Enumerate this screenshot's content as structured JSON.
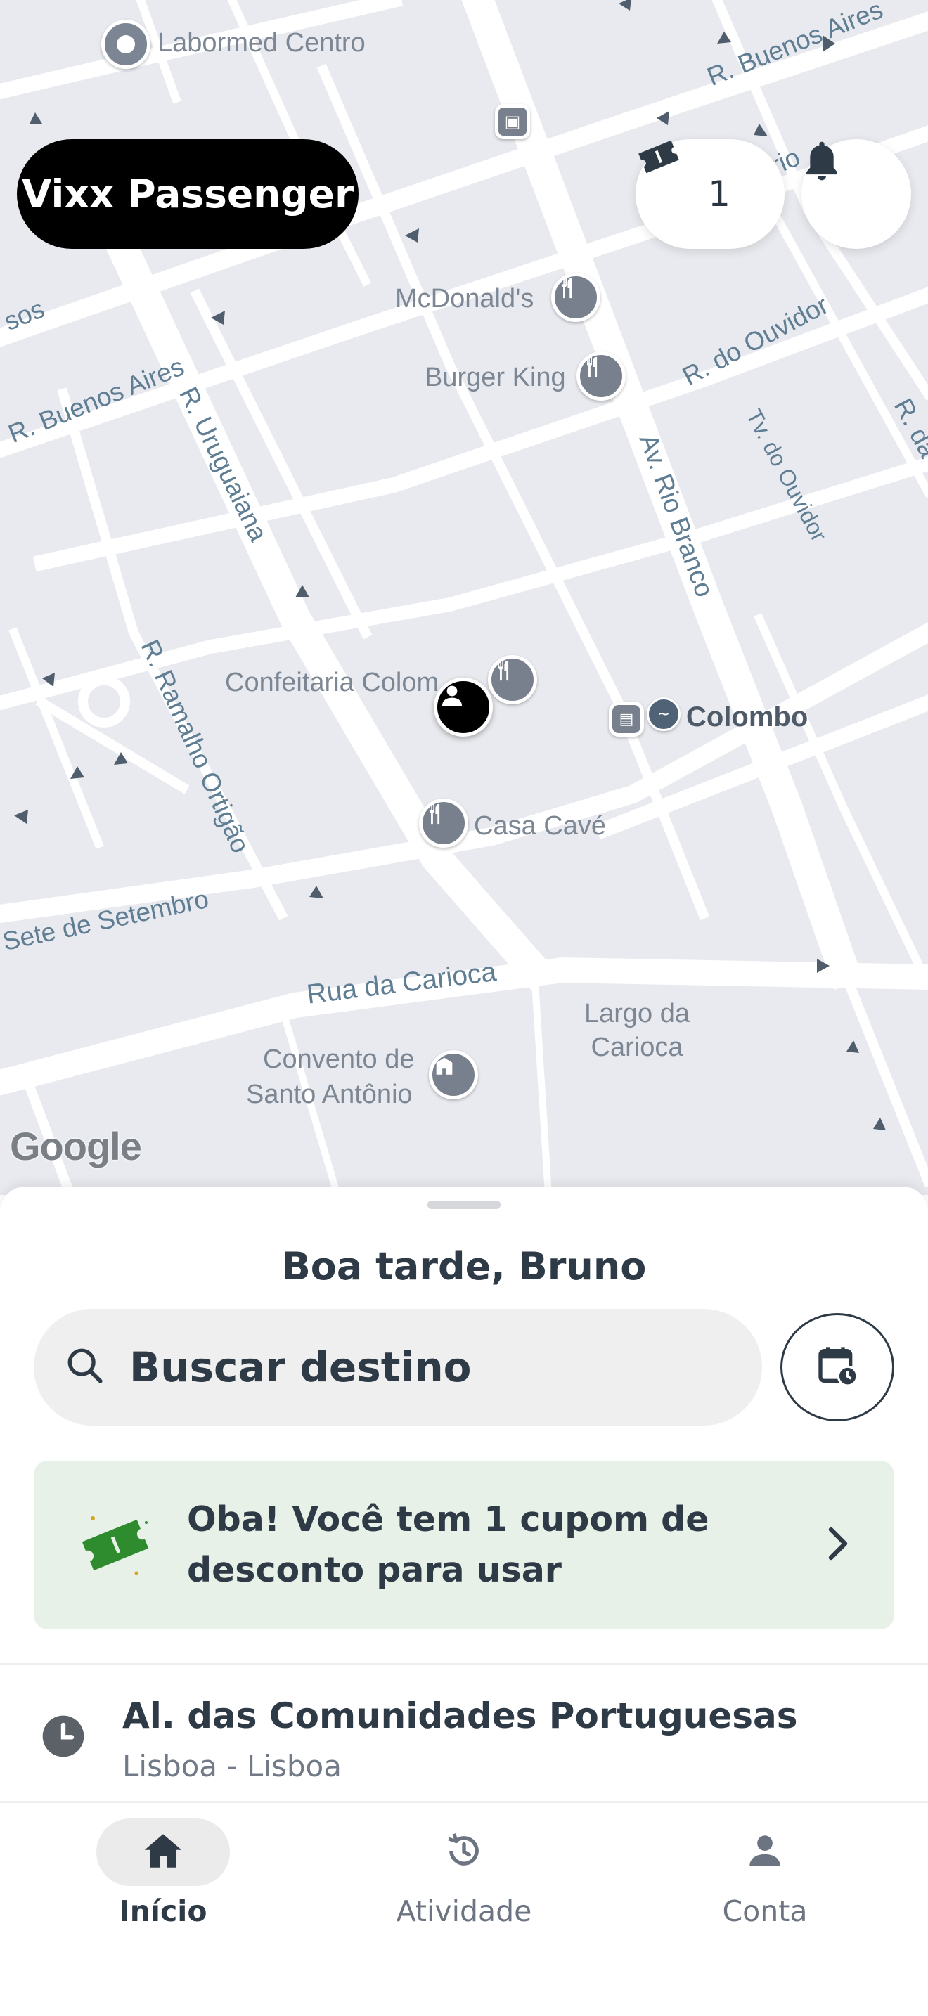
{
  "map": {
    "streets": {
      "buenos_aires_top": "R. Buenos Aires",
      "buenos_aires_left": "R. Buenos Aires",
      "rio_fragment": "rio",
      "sos_fragment": "sos",
      "do_ouvidor": "R. do Ouvidor",
      "tv_do_ouvidor": "Tv. do Ouvidor",
      "r_da_fragment": "R. da",
      "uruguaiana": "R. Uruguaiana",
      "rio_branco": "Av. Rio Branco",
      "ramalho_ortigao": "R. Ramalho Ortigão",
      "sete_de_setembro": "Sete de Setembro",
      "rua_da_carioca": "Rua da Carioca"
    },
    "pois": {
      "labormed": "Labormed Centro",
      "mcdonalds": "McDonald's",
      "burger_king": "Burger King",
      "confeitaria": "Confeitaria Colom",
      "colombo": "Colombo",
      "casa_cave": "Casa Cavé",
      "largo_carioca": "Largo da Carioca",
      "convento_line1": "Convento de",
      "convento_line2": "Santo Antônio"
    },
    "attribution": "Google"
  },
  "header": {
    "app_name": "Vixx Passenger",
    "coupon_count": "1"
  },
  "sheet": {
    "greeting": "Boa tarde, Bruno",
    "search_placeholder": "Buscar destino",
    "banner_text": "Oba! Você tem 1 cupom de desconto para usar",
    "recent": {
      "title": "Al. das Comunidades Portuguesas",
      "subtitle": "Lisboa - Lisboa"
    }
  },
  "nav": {
    "items": [
      {
        "label": "Início",
        "icon": "home-icon",
        "active": true
      },
      {
        "label": "Atividade",
        "icon": "history-icon",
        "active": false
      },
      {
        "label": "Conta",
        "icon": "person-icon",
        "active": false
      }
    ]
  },
  "colors": {
    "primary": "#000000",
    "accent_green": "#2e8b2e",
    "banner_bg": "#e8f1e8",
    "map_bg": "#e8eaef",
    "text": "#2f3a47"
  }
}
